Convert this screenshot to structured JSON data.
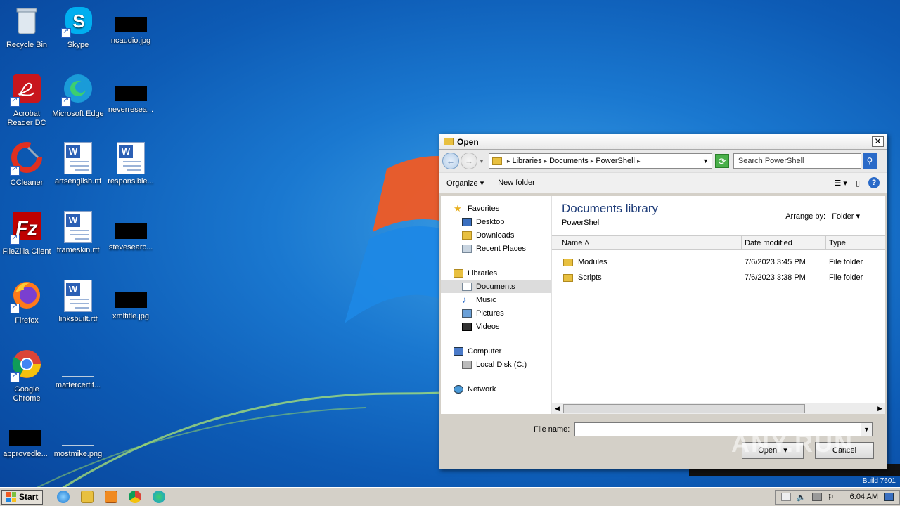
{
  "desktop": {
    "icons": [
      {
        "label": "Recycle Bin"
      },
      {
        "label": "Skype"
      },
      {
        "label": "ncaudio.jpg"
      },
      {
        "label": "Acrobat Reader DC"
      },
      {
        "label": "Microsoft Edge"
      },
      {
        "label": "neverresea..."
      },
      {
        "label": "CCleaner"
      },
      {
        "label": "artsenglish.rtf"
      },
      {
        "label": "responsible..."
      },
      {
        "label": "FileZilla Client"
      },
      {
        "label": "frameskin.rtf"
      },
      {
        "label": "stevesearc..."
      },
      {
        "label": "Firefox"
      },
      {
        "label": "linksbuilt.rtf"
      },
      {
        "label": "xmltitle.jpg"
      },
      {
        "label": "Google Chrome"
      },
      {
        "label": "mattercertif..."
      },
      {
        "label": "approvedle..."
      },
      {
        "label": "mostmike.png"
      }
    ]
  },
  "dialog": {
    "title": "Open",
    "close": "✕",
    "address": {
      "crumbs": [
        "Libraries",
        "Documents",
        "PowerShell"
      ]
    },
    "search_placeholder": "Search PowerShell",
    "toolbar": {
      "organize": "Organize",
      "new_folder": "New folder"
    },
    "nav": {
      "favorites": "Favorites",
      "desktop": "Desktop",
      "downloads": "Downloads",
      "recent": "Recent Places",
      "libraries": "Libraries",
      "documents": "Documents",
      "music": "Music",
      "pictures": "Pictures",
      "videos": "Videos",
      "computer": "Computer",
      "local_disk": "Local Disk (C:)",
      "network": "Network"
    },
    "library_title": "Documents library",
    "library_sub": "PowerShell",
    "arrange_label": "Arrange by:",
    "arrange_value": "Folder",
    "columns": {
      "name": "Name",
      "date": "Date modified",
      "type": "Type"
    },
    "files": [
      {
        "name": "Modules",
        "date": "7/6/2023 3:45 PM",
        "type": "File folder"
      },
      {
        "name": "Scripts",
        "date": "7/6/2023 3:38 PM",
        "type": "File folder"
      }
    ],
    "file_name_label": "File name:",
    "file_name_value": "",
    "open_button": "Open",
    "cancel_button": "Cancel"
  },
  "watermark": "ANY.RUN",
  "build": "Build 7601",
  "taskbar": {
    "start": "Start",
    "clock": "6:04 AM"
  },
  "colors": {
    "desktop_bg": "#1a78d0",
    "library_title": "#1e3c78",
    "accent": "#2a6ac8"
  }
}
